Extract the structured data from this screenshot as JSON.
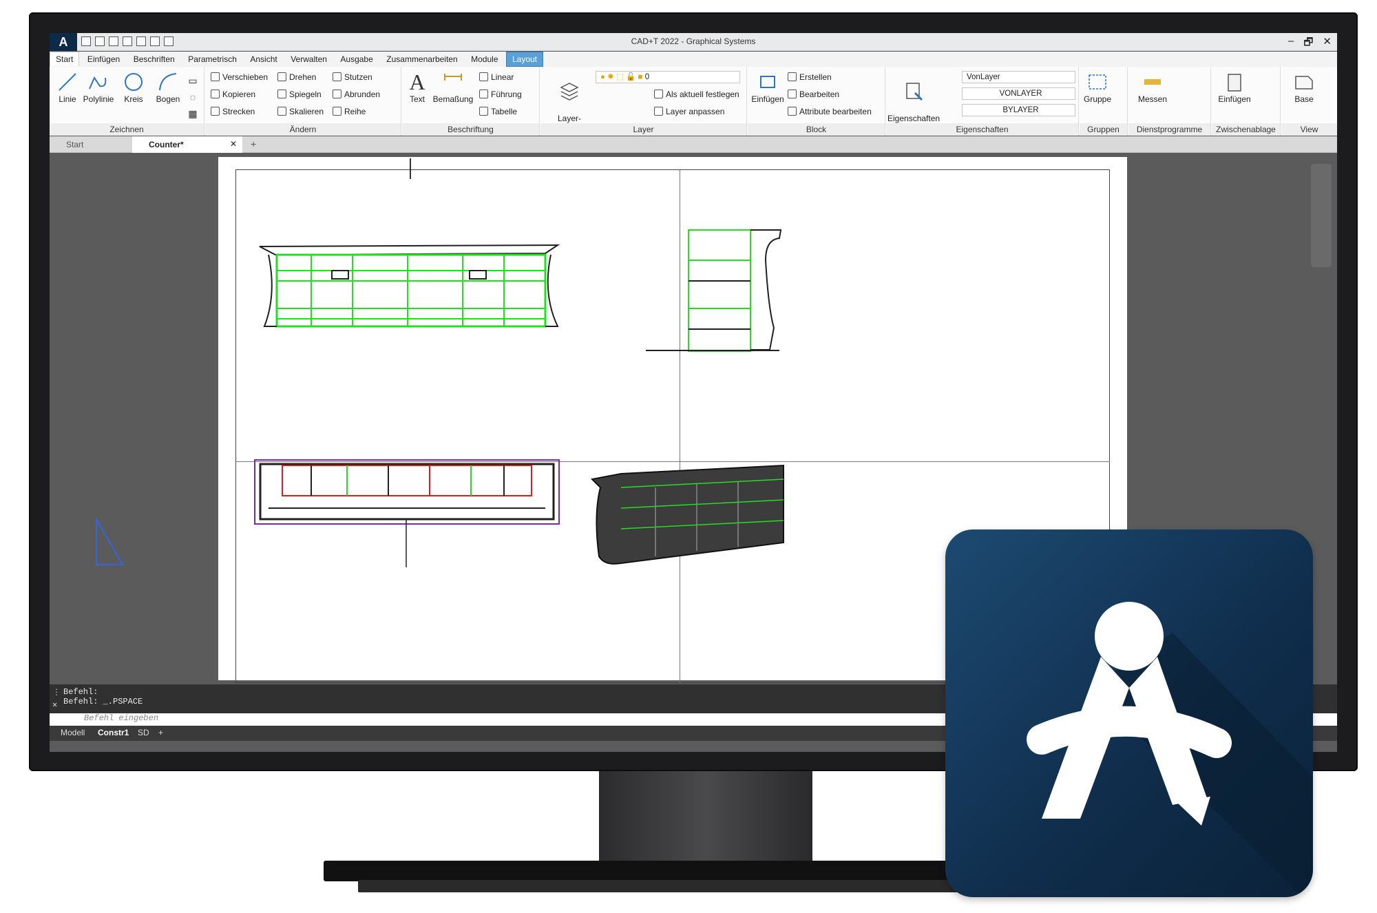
{
  "window": {
    "title": "CAD+T 2022 - Graphical Systems",
    "app_button": "A",
    "minimize": "–",
    "maximize": "🗗",
    "close": "✕"
  },
  "menu": {
    "tabs": [
      "Start",
      "Einfügen",
      "Beschriften",
      "Parametrisch",
      "Ansicht",
      "Verwalten",
      "Ausgabe",
      "Zusammenarbeiten",
      "Module",
      "Layout"
    ],
    "active_tab": "Start",
    "highlight_tab": "Layout"
  },
  "ribbon": {
    "zeichnen": {
      "title": "Zeichnen",
      "tools": [
        "Linie",
        "Polylinie",
        "Kreis",
        "Bogen"
      ]
    },
    "aendern": {
      "title": "Ändern",
      "rows": [
        [
          "Verschieben",
          "Drehen",
          "Stutzen"
        ],
        [
          "Kopieren",
          "Spiegeln",
          "Abrunden"
        ],
        [
          "Strecken",
          "Skalieren",
          "Reihe"
        ]
      ]
    },
    "beschriftung": {
      "title": "Beschriftung",
      "big": [
        "Text",
        "Bemaßung"
      ],
      "rows": [
        "Linear",
        "Führung",
        "Tabelle"
      ]
    },
    "layer": {
      "title": "Layer",
      "big": "Layer-\nEigenschaften",
      "layer_value": "0",
      "rows": [
        "Als aktuell festlegen",
        "Layer anpassen"
      ]
    },
    "block": {
      "title": "Block",
      "big": "Einfügen",
      "rows": [
        "Erstellen",
        "Bearbeiten",
        "Attribute bearbeiten"
      ]
    },
    "eigenschaften": {
      "title": "Eigenschaften",
      "big": "Eigenschaften\nanpassen",
      "color": "VonLayer",
      "linetype": "VONLAYER",
      "lineweight": "BYLAYER"
    },
    "gruppen": {
      "title": "Gruppen",
      "big": "Gruppe"
    },
    "dienstprogramme": {
      "title": "Dienstprogramme",
      "big": "Messen"
    },
    "zwischenablage": {
      "title": "Zwischenablage",
      "big": "Einfügen"
    },
    "view": {
      "title": "View",
      "big": "Base"
    }
  },
  "doc_tabs": {
    "start": "Start",
    "active": "Counter*",
    "close": "✕",
    "add": "+"
  },
  "command": {
    "lines": [
      "Befehl:",
      "Befehl: _.PSPACE"
    ],
    "placeholder": "Befehl eingeben"
  },
  "status_tabs": [
    "Modell",
    "Constr1",
    "SD",
    "+"
  ],
  "colors": {
    "accent": "#5aa0d8",
    "logo_bg": "#0f2c4a",
    "cad_green": "#22e01f"
  }
}
